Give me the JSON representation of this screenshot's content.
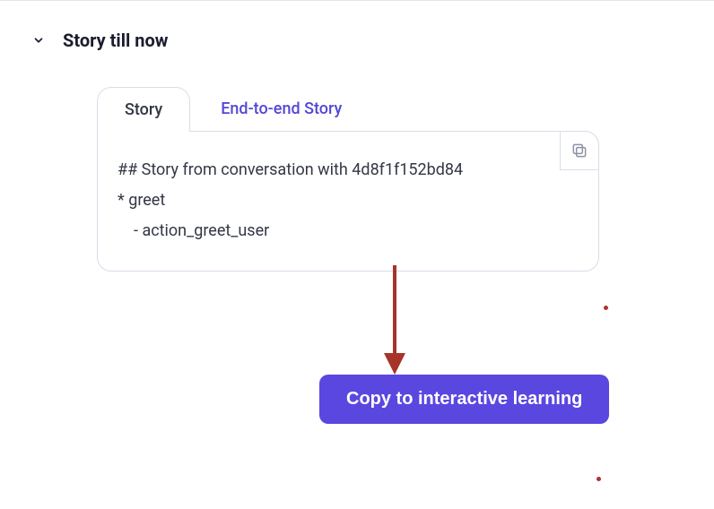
{
  "header": {
    "title": "Story till now"
  },
  "tabs": {
    "active": "Story",
    "inactive": "End-to-end Story"
  },
  "story": {
    "line1": "## Story from conversation with 4d8f1f152bd84",
    "line2": "* greet",
    "line3": "- action_greet_user"
  },
  "cta": {
    "label": "Copy to interactive learning"
  },
  "colors": {
    "accent": "#5a47e0",
    "annotation": "#a63428"
  }
}
